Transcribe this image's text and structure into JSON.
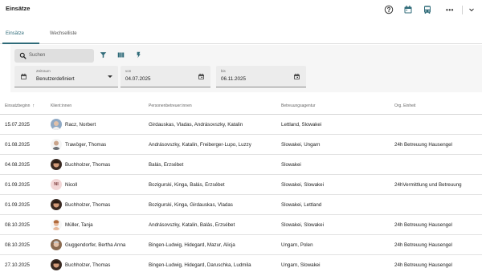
{
  "app": {
    "title": "Einsätze"
  },
  "header_icons": [
    {
      "icon": "help-circle-icon"
    },
    {
      "icon": "calendar-icon"
    },
    {
      "icon": "bus-icon"
    },
    {
      "icon": "more-icon",
      "glyph": "•••"
    },
    {
      "icon": "chevron-down-icon"
    }
  ],
  "tabs": [
    {
      "label": "Einsätze",
      "active": true
    },
    {
      "label": "Wechselliste",
      "active": false
    }
  ],
  "filters": {
    "search_placeholder": "Suchen",
    "zeitraum": {
      "label": "Zeitraum",
      "value": "Benutzerdefiniert"
    },
    "von": {
      "label": "von",
      "value": "04.07.2025"
    },
    "bis": {
      "label": "bis",
      "value": "06.11.2025"
    }
  },
  "colors": {
    "accent": "#2f6b79",
    "icon": "#2f6b79"
  },
  "table": {
    "columns": [
      "Einsatzbeginn",
      "Klient:innen",
      "Personenbetreuer:innen",
      "Betreuungsagentur",
      "Org. Einheit"
    ],
    "sort_indicator": "↑",
    "rows": [
      {
        "date": "15.07.2025",
        "client": "Racz, Norbert",
        "avatar": "photo-elderly-man",
        "caregivers": "Girdauskas, Vladas, Andrásovszky, Katalin",
        "agency": "Lettland, Slowakei",
        "unit": ""
      },
      {
        "date": "01.08.2025",
        "client": "Trawöger, Thomas",
        "avatar": "photo-man-glasses",
        "caregivers": "Andrásovszky, Katalin, Freiberger-Lupo, Luzzy",
        "agency": "Slowakei, Ungarn",
        "unit": "24h Betreuung Hausengel"
      },
      {
        "date": "04.08.2025",
        "client": "Buchholzer, Thomas",
        "avatar": "photo-man-dark",
        "caregivers": "Balás, Erzsébet",
        "agency": "Slowakei",
        "unit": ""
      },
      {
        "date": "01.09.2025",
        "client": "Nicoll",
        "avatar": "initials",
        "initials": "NI",
        "caregivers": "Bozigurski, Kinga, Balás, Erzsébet",
        "agency": "Slowakei, Slowakei",
        "unit": "24hVermittlung und Betreuung"
      },
      {
        "date": "01.09.2025",
        "client": "Buchholzer, Thomas",
        "avatar": "photo-man-dark",
        "caregivers": "Bozigurski, Kinga, Girdauskas, Vladas",
        "agency": "Slowakei, Lettland",
        "unit": ""
      },
      {
        "date": "08.10.2025",
        "client": "Müller, Tanja",
        "avatar": "photo-woman",
        "caregivers": "Andrásovszky, Katalin, Balás, Erzsébet",
        "agency": "Slowakei, Slowakei",
        "unit": "24h Betreuung Hausengel"
      },
      {
        "date": "08.10.2025",
        "client": "Guggendorfer, Bertha Anna",
        "avatar": "photo-elderly-woman",
        "caregivers": "Bingen-Ludwig, Hidegard, Mazur, Alicja",
        "agency": "Ungarn, Polen",
        "unit": "24h Betreuung Hausengel"
      },
      {
        "date": "27.10.2025",
        "client": "Buchholzer, Thomas",
        "avatar": "photo-man-dark",
        "caregivers": "Bingen-Ludwig, Hidegard, Daruschka, Ludmila",
        "agency": "Ungarn, Slowakei",
        "unit": "24h Betreuung Hausengel"
      }
    ]
  }
}
